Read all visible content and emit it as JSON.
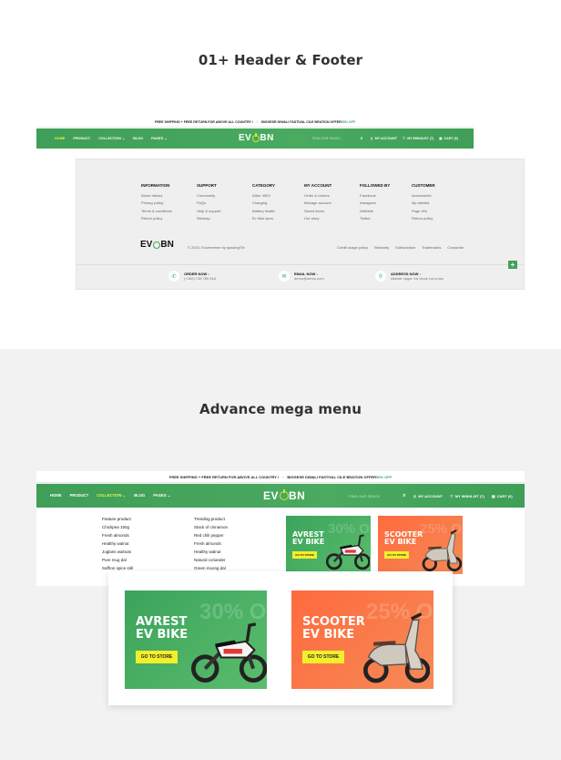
{
  "sections": {
    "top_title": "01+ Header & Footer",
    "bottom_title": "Advance mega menu"
  },
  "announcement": {
    "text1": "FREE SHIPPING + FREE RETURN FOR ABOVE ALL COUNTRY !",
    "separator": "/",
    "text2": "BIGGESR DIWALI FASTIVAL CILE BRATION OFFER",
    "offer": "50% OFF"
  },
  "nav": {
    "items": [
      "HOME",
      "PRODUCT",
      "COLLECTION",
      "BLOG",
      "PAGES"
    ],
    "logo_left": "EV",
    "logo_right": "BN",
    "search_placeholder": "FIND OUR SEACH",
    "account": "MY ACCOUNT",
    "wishlist": "MY WISHLIST (7)",
    "cart": "CART (0)"
  },
  "footer": {
    "columns": [
      {
        "heading": "INFORMATION",
        "links": [
          "About history",
          "Privacy policy",
          "Terms & conditions",
          "Return policy"
        ]
      },
      {
        "heading": "SUPPORT",
        "links": [
          "Community",
          "FAQs",
          "Help & support",
          "Sitemap"
        ]
      },
      {
        "heading": "CATEGORY",
        "links": [
          "Ather 450X",
          "Charging",
          "Battery health",
          "Ev bike tyres"
        ]
      },
      {
        "heading": "MY ACCOUNT",
        "links": [
          "Order & returns",
          "Manage account",
          "Saved items",
          "Our story"
        ]
      },
      {
        "heading": "FOLLOWED BY",
        "links": [
          "Facebook",
          "Instagram",
          "Dribbble",
          "Twitter"
        ]
      },
      {
        "heading": "CUSTOMER",
        "links": [
          "Accessories",
          "My wishlist",
          "Page 404",
          "Return policy"
        ]
      }
    ],
    "copyright": "© 2023, Ecommerce by spacingTM",
    "bottom_links": [
      "Credit usage policy",
      "Warranty",
      "Subscription",
      "Trademarks",
      "Corporate"
    ],
    "contacts": [
      {
        "title": "ORDER NOW :",
        "value": "(+260) 738 780 818"
      },
      {
        "title": "EMAIL NOW :",
        "value": "demo@demo.com"
      },
      {
        "title": "ADDRESS NOW :",
        "value": "Akshar nagar 1st block 1st cross"
      }
    ],
    "plus": "+"
  },
  "mega_menu": {
    "col1": {
      "heading": "Feature product",
      "items": [
        "Chickpea 150g",
        "Fresh almonds",
        "Healthy walnut",
        "Joglans walnuts",
        "Pure mug dal",
        "Saffron spice still"
      ]
    },
    "col2": {
      "heading": "Trending product",
      "items": [
        "Stack of cinnamon",
        "Red chili pepper",
        "Fresh almonds",
        "Healthy walnut",
        "Natural coriander",
        "Green moong dal"
      ]
    }
  },
  "promos": [
    {
      "line1": "AVREST",
      "line2": "EV BIKE",
      "button": "GO TO STORE",
      "ghost": "30% OFF"
    },
    {
      "line1": "SCOOTER",
      "line2": "EV BIKE",
      "button": "GO TO STORE",
      "ghost": "25% OFF"
    }
  ],
  "colors": {
    "brand_green": "#3fa35a",
    "accent_yellow": "#f3ef2a",
    "promo_orange": "#ff6a3d",
    "active_nav": "#e8f54a"
  }
}
